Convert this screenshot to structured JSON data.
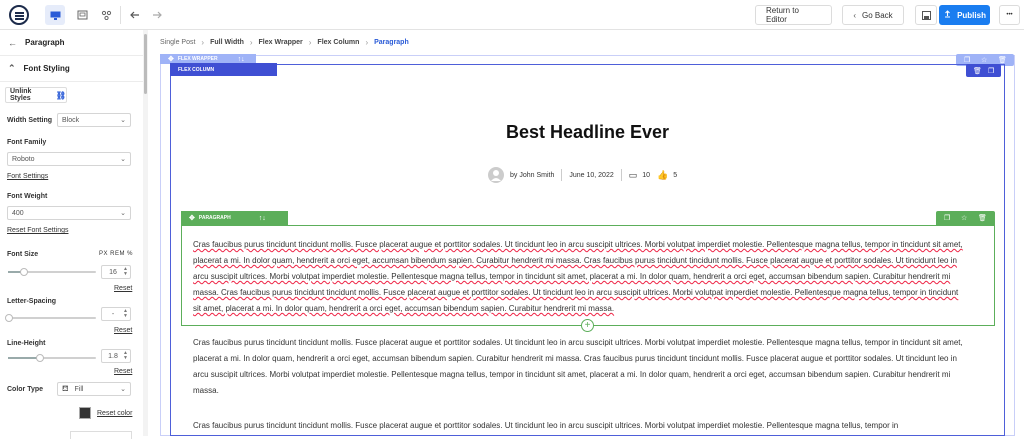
{
  "topbar": {
    "return_label": "Return to Editor",
    "back_label": "Go Back",
    "publish_label": "Publish",
    "more_label": "•••"
  },
  "sidebar": {
    "title": "Paragraph",
    "section": "Font Styling",
    "unlink_label": "Unlink Styles",
    "width_setting_label": "Width Setting",
    "width_setting_value": "Block",
    "font_family_label": "Font Family",
    "font_family_value": "Roboto",
    "font_settings_link": "Font Settings",
    "font_weight_label": "Font Weight",
    "font_weight_value": "400",
    "reset_font_settings": "Reset Font Settings",
    "font_size_label": "Font Size",
    "units": "PX  REM  %",
    "font_size_value": "16",
    "font_size_fraction": 0.18,
    "reset_label": "Reset",
    "letter_spacing_label": "Letter-Spacing",
    "letter_spacing_value": "-",
    "line_height_label": "Line-Height",
    "line_height_value": "1.8",
    "line_height_fraction": 0.36,
    "color_type_label": "Color Type",
    "color_type_value": "Fill",
    "reset_color": "Reset color",
    "color_swatch": "#333333"
  },
  "breadcrumbs": [
    "Single Post",
    "Full Width",
    "Flex Wrapper",
    "Flex Column",
    "Paragraph"
  ],
  "labels": {
    "flex_wrapper": "FLEX WRAPPER",
    "flex_column": "FLEX COLUMN",
    "paragraph": "PARAGRAPH"
  },
  "article": {
    "headline": "Best Headline Ever",
    "author": "by John Smith",
    "date": "June 10, 2022",
    "comments": "10",
    "likes": "5"
  },
  "paragraphs": [
    "Cras faucibus purus tincidunt tincidunt mollis. Fusce placerat augue et porttitor sodales. Ut tincidunt leo in arcu suscipit ultrices. Morbi volutpat imperdiet molestie. Pellentesque magna tellus, tempor in tincidunt sit amet, placerat a mi. In dolor quam, hendrerit a orci eget, accumsan bibendum sapien. Curabitur hendrerit mi massa. Cras faucibus purus tincidunt tincidunt mollis. Fusce placerat augue et porttitor sodales. Ut tincidunt leo in arcu suscipit ultrices. Morbi volutpat imperdiet molestie. Pellentesque magna tellus, tempor in tincidunt sit amet, placerat a mi. In dolor quam, hendrerit a orci eget, accumsan bibendum sapien. Curabitur hendrerit mi massa. Cras faucibus purus tincidunt tincidunt mollis. Fusce placerat augue et porttitor sodales. Ut tincidunt leo in arcu suscipit ultrices. Morbi volutpat imperdiet molestie. Pellentesque magna tellus, tempor in tincidunt sit amet, placerat a mi. In dolor quam, hendrerit a orci eget, accumsan bibendum sapien. Curabitur hendrerit mi massa.",
    "Cras faucibus purus tincidunt tincidunt mollis. Fusce placerat augue et porttitor sodales. Ut tincidunt leo in arcu suscipit ultrices. Morbi volutpat imperdiet molestie. Pellentesque magna tellus, tempor in tincidunt sit amet, placerat a mi. In dolor quam, hendrerit a orci eget, accumsan bibendum sapien. Curabitur hendrerit mi massa. Cras faucibus purus tincidunt tincidunt mollis. Fusce placerat augue et porttitor sodales. Ut tincidunt leo in arcu suscipit ultrices. Morbi volutpat imperdiet molestie. Pellentesque magna tellus, tempor in tincidunt sit amet, placerat a mi. In dolor quam, hendrerit a orci eget, accumsan bibendum sapien. Curabitur hendrerit mi massa.",
    "Cras faucibus purus tincidunt tincidunt mollis. Fusce placerat augue et porttitor sodales. Ut tincidunt leo in arcu suscipit ultrices. Morbi volutpat imperdiet molestie. Pellentesque magna tellus, tempor in"
  ],
  "colors": {
    "accent": "#1a7df0",
    "flex_column": "#3f4fd3",
    "paragraph_green": "#5cae5a"
  }
}
